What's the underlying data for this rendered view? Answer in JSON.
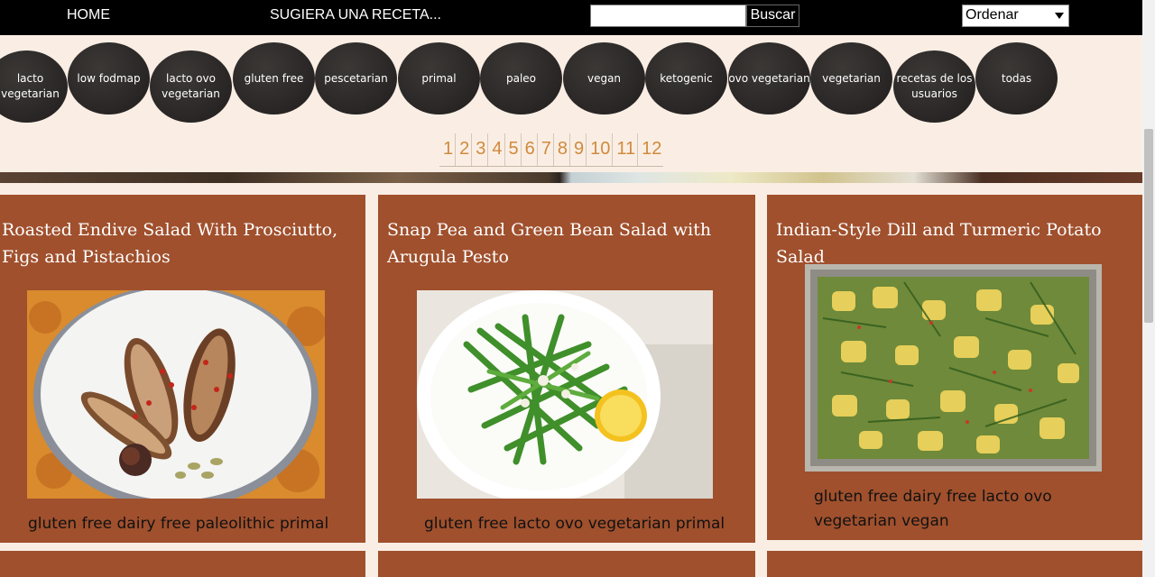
{
  "nav": {
    "home": "HOME",
    "suggest": "SUGIERA UNA RECETA...",
    "search_value": "",
    "search_button": "Buscar",
    "sort_selected": "Ordenar"
  },
  "diets": [
    "lacto vegetarian",
    "low fodmap",
    "lacto ovo vegetarian",
    "gluten free",
    "pescetarian",
    "primal",
    "paleo",
    "vegan",
    "ketogenic",
    "ovo vegetarian",
    "vegetarian",
    "recetas de los usuarios",
    "todas"
  ],
  "pages": [
    "1",
    "2",
    "3",
    "4",
    "5",
    "6",
    "7",
    "8",
    "9",
    "10",
    "11",
    "12"
  ],
  "recipes": [
    {
      "title": "Roasted Endive Salad With Prosciutto, Figs and Pistachios",
      "tags": "gluten free dairy free paleolithic primal",
      "image": "roasted-endive-plate"
    },
    {
      "title": "Snap Pea and Green Bean Salad with Arugula Pesto",
      "tags": "gluten free lacto ovo vegetarian primal",
      "image": "green-bean-salad-plate"
    },
    {
      "title": "Indian-Style Dill and Turmeric Potato Salad",
      "tags": "gluten free dairy free lacto ovo vegetarian vegan",
      "image": "potato-salad-tray"
    }
  ],
  "colors": {
    "page_bg": "#faeee4",
    "nav_bg": "#000000",
    "card_bg": "#a0502d",
    "pill_bg": "#2b2827",
    "page_link": "#d08a3c"
  }
}
